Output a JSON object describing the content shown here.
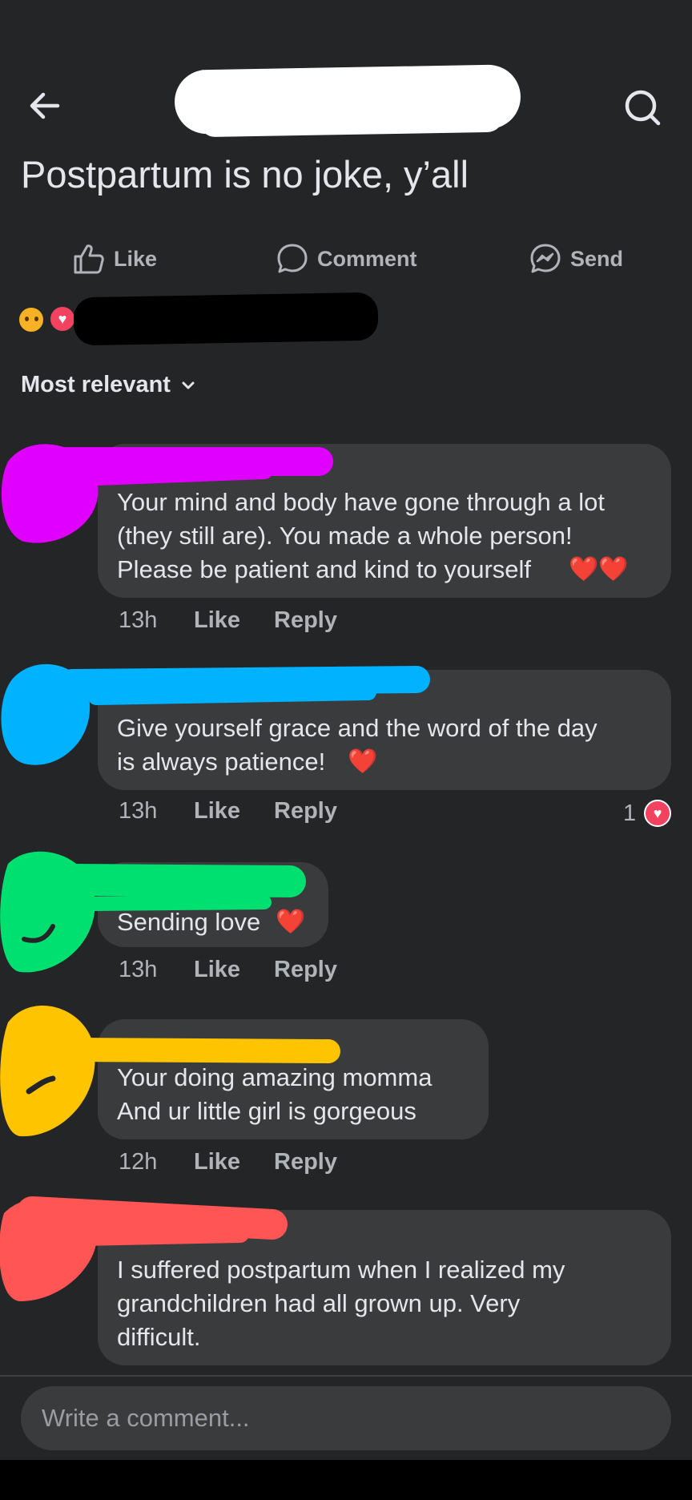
{
  "header": {
    "back_icon": "arrow-left-icon",
    "search_icon": "search-icon",
    "post_title": "Postpartum is no joke, y’all"
  },
  "actions": {
    "like_label": "Like",
    "comment_label": "Comment",
    "send_label": "Send"
  },
  "sort": {
    "label": "Most relevant"
  },
  "comments": [
    {
      "text": "Your mind and body have gone through a lot\n(they still are). You made a whole person!\nPlease be patient and kind to yourself",
      "emoji": "❤️❤️",
      "time": "13h",
      "like": "Like",
      "reply": "Reply",
      "scribble_color": "#e000ff"
    },
    {
      "text": "Give yourself grace and the word of the day\nis always patience!",
      "emoji": "❤️",
      "time": "13h",
      "like": "Like",
      "reply": "Reply",
      "reaction_count": "1",
      "scribble_color": "#00b2ff"
    },
    {
      "text": "Sending love",
      "emoji": "❤️",
      "time": "13h",
      "like": "Like",
      "reply": "Reply",
      "scribble_color": "#00e070"
    },
    {
      "text": "Your doing amazing momma\nAnd ur little girl is gorgeous",
      "time": "12h",
      "like": "Like",
      "reply": "Reply",
      "scribble_color": "#ffc400"
    },
    {
      "text": "I suffered postpartum when I realized my\ngrandchildren had all grown up. Very\ndifficult.",
      "scribble_color": "#ff5555"
    }
  ],
  "composer": {
    "placeholder": "Write a comment..."
  }
}
